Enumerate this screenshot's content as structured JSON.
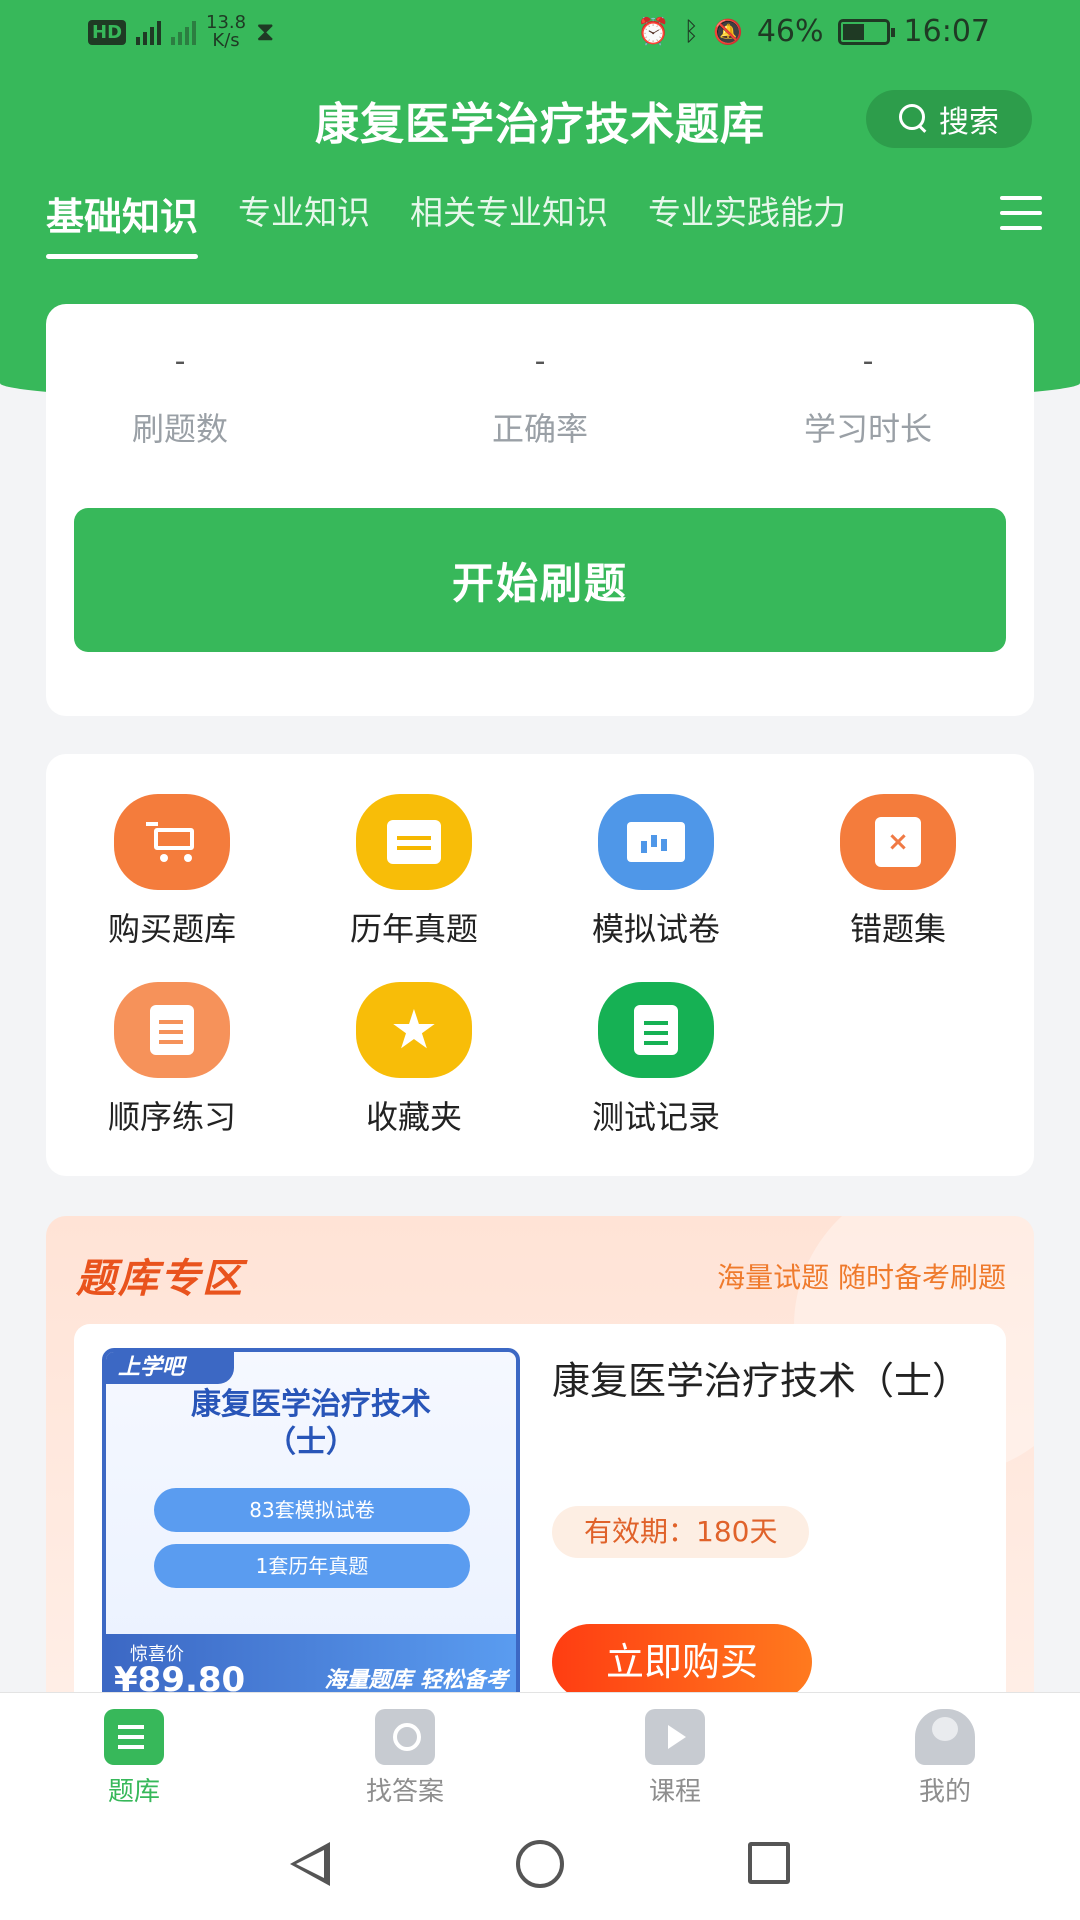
{
  "status_bar": {
    "hd": "HD",
    "net_speed": "13.8",
    "net_unit": "K/s",
    "battery": "46%",
    "time": "16:07"
  },
  "header": {
    "title": "康复医学治疗技术题库",
    "search_label": "搜索"
  },
  "tabs": [
    "基础知识",
    "专业知识",
    "相关专业知识",
    "专业实践能力"
  ],
  "stats": [
    {
      "value": "-",
      "label": "刷题数"
    },
    {
      "value": "-",
      "label": "正确率"
    },
    {
      "value": "-",
      "label": "学习时长"
    }
  ],
  "start_button": "开始刷题",
  "functions": [
    {
      "label": "购买题库",
      "icon": "cart-icon",
      "color": "#f47c3c"
    },
    {
      "label": "历年真题",
      "icon": "calendar-icon",
      "color": "#f8bd08"
    },
    {
      "label": "模拟试卷",
      "icon": "presentation-board-icon",
      "color": "#4f97e8"
    },
    {
      "label": "错题集",
      "icon": "wrong-file-icon",
      "color": "#f47c3c"
    },
    {
      "label": "顺序练习",
      "icon": "edit-doc-icon",
      "color": "#f6925a"
    },
    {
      "label": "收藏夹",
      "icon": "star-icon",
      "color": "#f8bd08"
    },
    {
      "label": "测试记录",
      "icon": "list-doc-icon",
      "color": "#16b154"
    }
  ],
  "zone": {
    "title": "题库专区",
    "subtitle": "海量试题 随时备考刷题"
  },
  "product": {
    "cover_brand": "上学吧",
    "cover_title": "康复医学治疗技术（士）",
    "cover_pill_1": "83套模拟试卷",
    "cover_pill_2": "1套历年真题",
    "cover_price_label": "惊喜价",
    "cover_price": "¥89.80",
    "cover_slogan": "海量题库 轻松备考",
    "title": "康复医学治疗技术（士）",
    "validity": "有效期：180天",
    "buy_label": "立即购买"
  },
  "bottom_nav": [
    {
      "label": "题库",
      "icon": "question-bank-icon",
      "active": true
    },
    {
      "label": "找答案",
      "icon": "find-answer-icon",
      "active": false
    },
    {
      "label": "课程",
      "icon": "course-play-icon",
      "active": false
    },
    {
      "label": "我的",
      "icon": "profile-icon",
      "active": false
    }
  ]
}
